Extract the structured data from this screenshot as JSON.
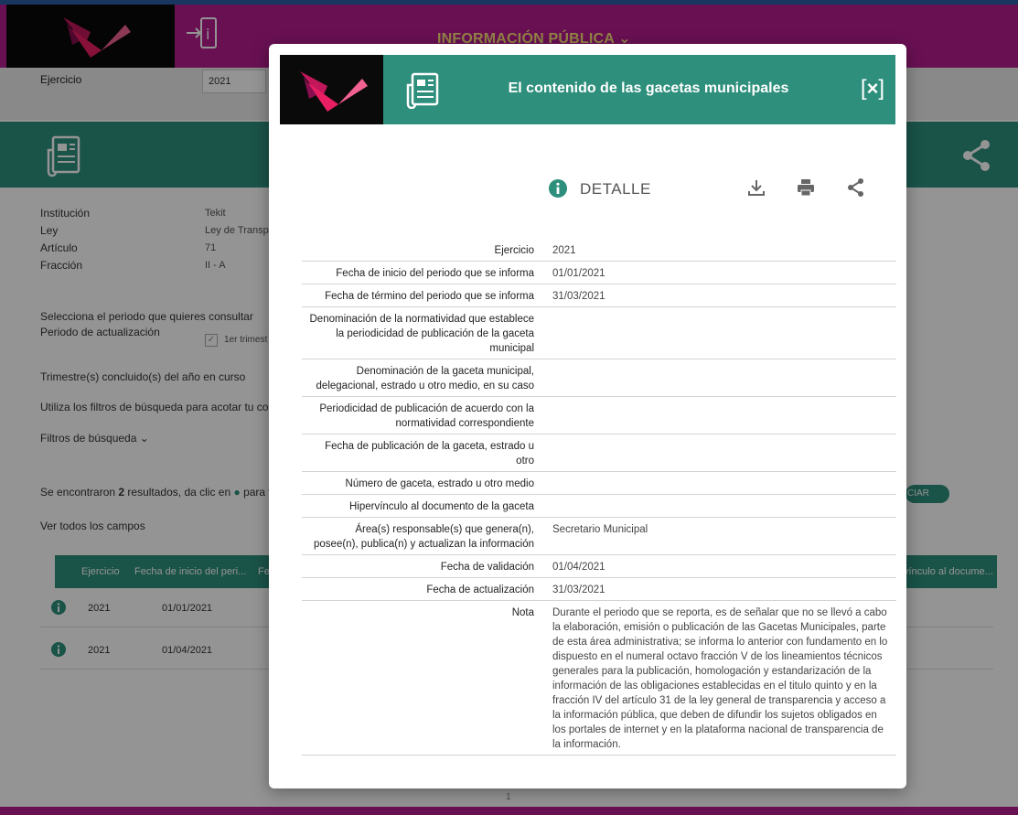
{
  "header": {
    "title": "INFORMACIÓN PÚBLICA",
    "brand_color": "#b51c8f",
    "accent_color": "#2e8f7c",
    "title_color": "#ffe27a"
  },
  "background": {
    "ejercicio_label": "Ejercicio",
    "ejercicio_value": "2021",
    "fields": [
      {
        "label": "Institución",
        "value": "Tekit"
      },
      {
        "label": "Ley",
        "value": "Ley de Transp"
      },
      {
        "label": "Artículo",
        "value": "71"
      },
      {
        "label": "Fracción",
        "value": "II - A"
      }
    ],
    "periodo_intro": "Selecciona el periodo que quieres consultar",
    "periodo_label": "Periodo de actualización",
    "periodo_option": "1er trimest",
    "trimestres": "Trimestre(s) concluido(s) del año en curso",
    "filtros_hint": "Utiliza los filtros de búsqueda para acotar tu cons",
    "filtros_label": "Filtros de búsqueda",
    "results_pre": "Se encontraron ",
    "results_count": "2",
    "results_post": " resultados, da clic en ",
    "results_tail": " para v",
    "share_pill": "CIAR",
    "ver_todos": "Ver todos los campos",
    "table_headers": [
      "Ejercicio",
      "Fecha de inicio del peri...",
      "Fe",
      "vínculo al docume..."
    ],
    "rows": [
      {
        "ejercicio": "2021",
        "fecha": "01/01/2021"
      },
      {
        "ejercicio": "2021",
        "fecha": "01/04/2021"
      }
    ],
    "pager": "1"
  },
  "modal": {
    "title": "El contenido de las gacetas municipales",
    "close_label": "×",
    "detalle_label": "DETALLE",
    "icons": {
      "download": "download-icon",
      "print": "print-icon",
      "share": "share-icon",
      "info": "info-icon"
    },
    "details": [
      {
        "label": "Ejercicio",
        "value": "2021"
      },
      {
        "label": "Fecha de inicio del periodo que se informa",
        "value": "01/01/2021"
      },
      {
        "label": "Fecha de término del periodo que se informa",
        "value": "31/03/2021"
      },
      {
        "label": "Denominación de la normatividad que establece la periodicidad de publicación de la gaceta municipal",
        "value": ""
      },
      {
        "label": "Denominación de la gaceta municipal, delegacional, estrado u otro medio, en su caso",
        "value": ""
      },
      {
        "label": "Periodicidad de publicación de acuerdo con la normatividad correspondiente",
        "value": ""
      },
      {
        "label": "Fecha de publicación de la gaceta, estrado u otro",
        "value": ""
      },
      {
        "label": "Número de gaceta, estrado u otro medio",
        "value": ""
      },
      {
        "label": "Hipervínculo al documento de la gaceta",
        "value": ""
      },
      {
        "label": "Área(s) responsable(s) que genera(n), posee(n), publica(n) y actualizan la información",
        "value": "Secretario Municipal"
      },
      {
        "label": "Fecha de validación",
        "value": "01/04/2021"
      },
      {
        "label": "Fecha de actualización",
        "value": "31/03/2021"
      },
      {
        "label": "Nota",
        "value": "Durante el periodo que se reporta, es de señalar que no se llevó a cabo la elaboración, emisión o publicación de las Gacetas Municipales, parte de esta área administrativa; se informa lo anterior con fundamento en lo dispuesto en el numeral octavo fracción V de los lineamientos técnicos generales para la publicación, homologación y estandarización de la información de las obligaciones establecidas en el titulo quinto y en la fracción IV del artículo 31 de la ley general de transparencia y acceso a la información pública, que deben de difundir los sujetos obligados en los portales de internet y en la plataforma nacional de transparencia de la información."
      }
    ]
  }
}
